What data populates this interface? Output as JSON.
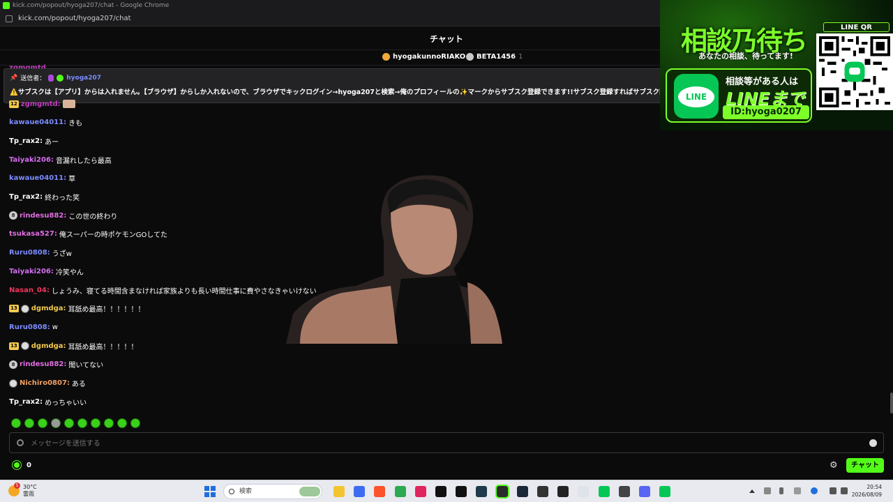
{
  "window": {
    "title": "kick.com/popout/hyoga207/chat - Google Chrome"
  },
  "address": {
    "url": "kick.com/popout/hyoga207/chat"
  },
  "chat": {
    "title": "チャット",
    "gifters": [
      {
        "name": "hyogakunnoRIAKO",
        "count": "5",
        "color": "#f2a93b"
      },
      {
        "name": "BETA1456",
        "count": "1",
        "color": "#c9c9c9"
      }
    ],
    "partial_top_user": "zgmgmtd",
    "pinned": {
      "label": "送信者：",
      "user": "hyoga207",
      "message": "⚠️サブスクは【アプリ】からは入れません。【ブラウザ】からしか入れないので、ブラウザでキックログイン→hyoga207と検索→俺のプロフィールの✨マークからサブスク登録できます!!サブスク登録すればサブスク限定"
    },
    "messages": [
      {
        "user": "zgmgmtd",
        "text": "",
        "color": "#c23fbf",
        "badges": [
          "sub"
        ],
        "sub": "12",
        "emote": true
      },
      {
        "user": "kawaue04011",
        "text": "きも",
        "color": "#7b8cff",
        "badges": []
      },
      {
        "user": "Tp_rax2",
        "text": "あー",
        "color": "#ffffff",
        "badges": []
      },
      {
        "user": "Taiyaki206",
        "text": "音漏れしたら最高",
        "color": "#d36cf0",
        "badges": []
      },
      {
        "user": "kawaue04011",
        "text": "草",
        "color": "#7b8cff",
        "badges": []
      },
      {
        "user": "Tp_rax2",
        "text": "終わった笑",
        "color": "#ffffff",
        "badges": []
      },
      {
        "user": "rindesu882",
        "text": "この世の終わり",
        "color": "#e06ee0",
        "badges": [
          "gift"
        ],
        "gift": "8"
      },
      {
        "user": "tsukasa527",
        "text": "俺スーパーの時ポケモンGOしてた",
        "color": "#e06ee0",
        "badges": []
      },
      {
        "user": "Ruru0808",
        "text": "うざw",
        "color": "#7b8cff",
        "badges": []
      },
      {
        "user": "Taiyaki206",
        "text": "冷笑やん",
        "color": "#d36cf0",
        "badges": []
      },
      {
        "user": "Nasan_04",
        "text": "しょうみ、寝てる時間含まなければ家族よりも長い時間仕事に費やさなきゃいけない",
        "color": "#f0365a",
        "badges": []
      },
      {
        "user": "dgmdga",
        "text": "耳舐め最高！！！！！！",
        "color": "#f2c94c",
        "badges": [
          "sub",
          "av"
        ],
        "sub": "13"
      },
      {
        "user": "Ruru0808",
        "text": "w",
        "color": "#7b8cff",
        "badges": []
      },
      {
        "user": "dgmdga",
        "text": "耳舐め最高！！！！！",
        "color": "#f2c94c",
        "badges": [
          "sub",
          "av"
        ],
        "sub": "13"
      },
      {
        "user": "rindesu882",
        "text": "聞いてない",
        "color": "#e06ee0",
        "badges": [
          "gift"
        ],
        "gift": "8"
      },
      {
        "user": "Nichiro0807",
        "text": "ある",
        "color": "#f0a060",
        "badges": [
          "av"
        ]
      },
      {
        "user": "Tp_rax2",
        "text": "めっちゃいい",
        "color": "#ffffff",
        "badges": []
      }
    ],
    "input_placeholder": "メッセージを送信する",
    "points": "0",
    "send_label": "チャット"
  },
  "ad": {
    "title": "相談乃待ち",
    "subtitle": "あなたの相談、待ってます!",
    "line_logo": "LINE",
    "line1": "相談等がある人は",
    "line2": "LINEまで",
    "line3": "ID:hyoga0207",
    "qr_label": "LINE QR"
  },
  "taskbar": {
    "weather_temp": "30°C",
    "weather_state": "雷雨",
    "weather_badge": "5",
    "search_placeholder": "検索",
    "time": "20:54",
    "date": "2026/08/09",
    "icons": [
      "file-explorer-icon",
      "app-icon",
      "brave-icon",
      "chrome-icon",
      "app-icon",
      "tiktok-icon",
      "app-icon",
      "app-icon",
      "kick-icon",
      "steam-icon",
      "app-icon",
      "obs-icon",
      "app-icon",
      "line-icon",
      "app-icon",
      "discord-icon",
      "line-icon"
    ]
  }
}
